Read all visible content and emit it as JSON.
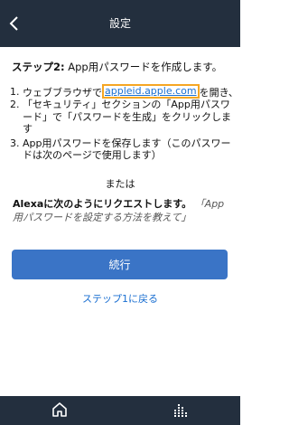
{
  "header": {
    "title": "設定"
  },
  "step2": {
    "label": "ステップ2:",
    "text": " App用パスワードを作成します。",
    "items": [
      {
        "num": "1.",
        "before": "ウェブブラウザで",
        "link": "appleid.apple.com",
        "after": "を開き、"
      },
      {
        "num": "2.",
        "text": "「セキュリティ」セクションの「App用パスワード」で「パスワードを生成」をクリックします"
      },
      {
        "num": "3.",
        "text": "App用パスワードを保存します（このパスワードは次のページで使用します）"
      }
    ]
  },
  "or_text": "または",
  "alexa": {
    "bold": "Alexaに次のようにリクエストします。",
    "phrase_start": "「App",
    "phrase_rest": "用パスワードを設定する方法を教えて」"
  },
  "continue_label": "続行",
  "back_step_label": "ステップ1に戻る"
}
